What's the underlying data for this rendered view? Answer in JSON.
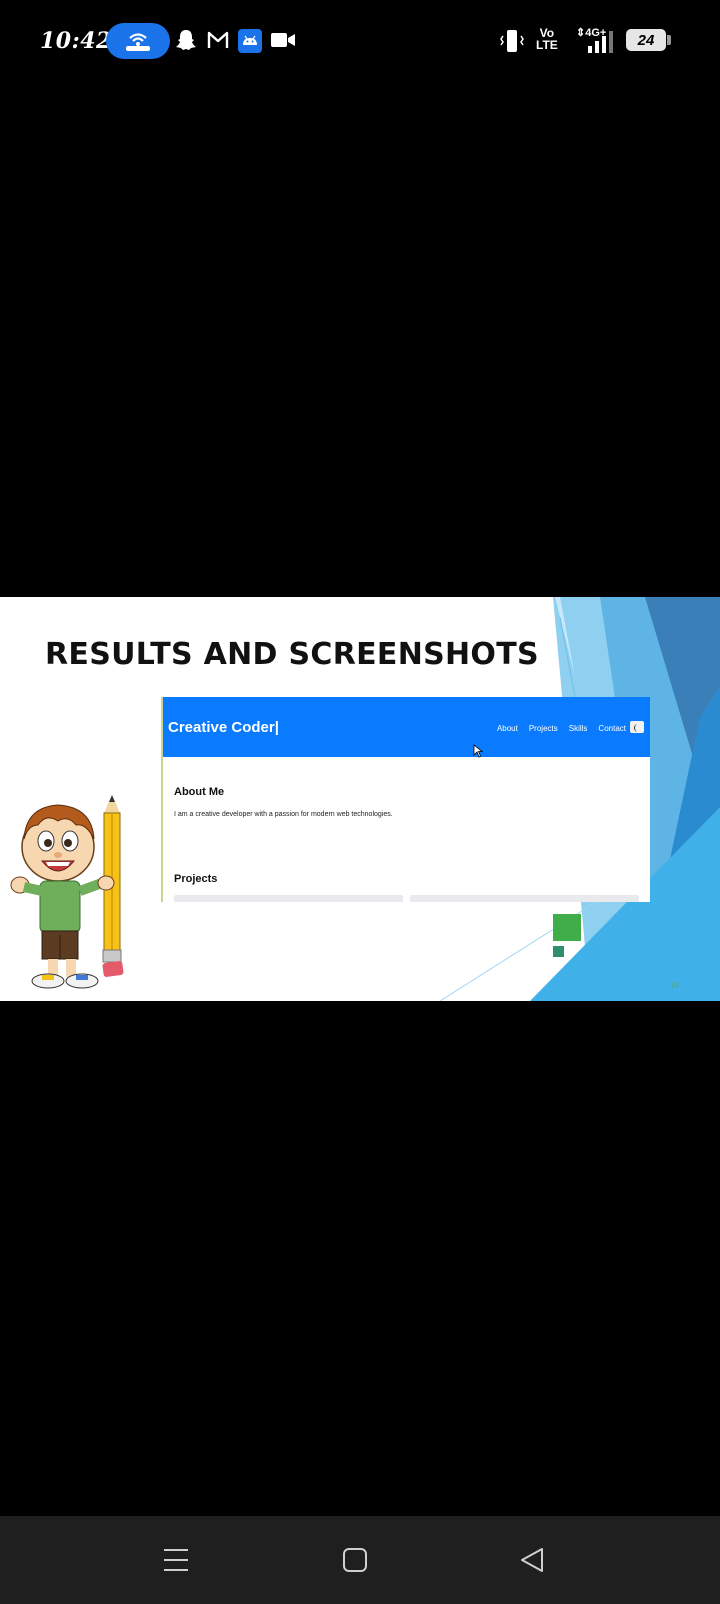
{
  "status_bar": {
    "time": "10:42",
    "volte_line1": "Vo",
    "volte_line2": "LTE",
    "network": "4G+",
    "battery": "24"
  },
  "slide": {
    "title": "RESULTS AND SCREENSHOTS",
    "slide_number": "10",
    "accent_green": "#3fae49",
    "accent_blue": "#1e88d4"
  },
  "website": {
    "logo": "Creative Coder|",
    "header_color": "#0a7bff",
    "nav": [
      "About",
      "Projects",
      "Skills",
      "Contact"
    ],
    "about_title": "About Me",
    "about_text": "I am a creative developer with a passion for modern web technologies.",
    "projects_title": "Projects"
  },
  "navigation": {
    "menu_icon": "menu-icon",
    "home_icon": "home-icon",
    "back_icon": "back-icon"
  }
}
